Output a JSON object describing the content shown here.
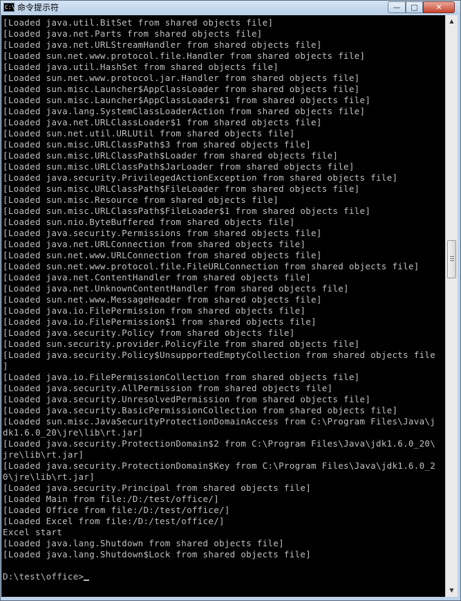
{
  "window": {
    "title": "命令提示符",
    "app_icon_text": "C:\\",
    "controls": {
      "minimize": "—",
      "maximize": "□",
      "close": "✕"
    }
  },
  "console": {
    "lines": [
      "[Loaded java.util.BitSet from shared objects file]",
      "[Loaded java.net.Parts from shared objects file]",
      "[Loaded java.net.URLStreamHandler from shared objects file]",
      "[Loaded sun.net.www.protocol.file.Handler from shared objects file]",
      "[Loaded java.util.HashSet from shared objects file]",
      "[Loaded sun.net.www.protocol.jar.Handler from shared objects file]",
      "[Loaded sun.misc.Launcher$AppClassLoader from shared objects file]",
      "[Loaded sun.misc.Launcher$AppClassLoader$1 from shared objects file]",
      "[Loaded java.lang.SystemClassLoaderAction from shared objects file]",
      "[Loaded java.net.URLClassLoader$1 from shared objects file]",
      "[Loaded sun.net.util.URLUtil from shared objects file]",
      "[Loaded sun.misc.URLClassPath$3 from shared objects file]",
      "[Loaded sun.misc.URLClassPath$Loader from shared objects file]",
      "[Loaded sun.misc.URLClassPath$JarLoader from shared objects file]",
      "[Loaded java.security.PrivilegedActionException from shared objects file]",
      "[Loaded sun.misc.URLClassPath$FileLoader from shared objects file]",
      "[Loaded sun.misc.Resource from shared objects file]",
      "[Loaded sun.misc.URLClassPath$FileLoader$1 from shared objects file]",
      "[Loaded sun.nio.ByteBuffered from shared objects file]",
      "[Loaded java.security.Permissions from shared objects file]",
      "[Loaded java.net.URLConnection from shared objects file]",
      "[Loaded sun.net.www.URLConnection from shared objects file]",
      "[Loaded sun.net.www.protocol.file.FileURLConnection from shared objects file]",
      "[Loaded java.net.ContentHandler from shared objects file]",
      "[Loaded java.net.UnknownContentHandler from shared objects file]",
      "[Loaded sun.net.www.MessageHeader from shared objects file]",
      "[Loaded java.io.FilePermission from shared objects file]",
      "[Loaded java.io.FilePermission$1 from shared objects file]",
      "[Loaded java.security.Policy from shared objects file]",
      "[Loaded sun.security.provider.PolicyFile from shared objects file]",
      "[Loaded java.security.Policy$UnsupportedEmptyCollection from shared objects file",
      "]",
      "[Loaded java.io.FilePermissionCollection from shared objects file]",
      "[Loaded java.security.AllPermission from shared objects file]",
      "[Loaded java.security.UnresolvedPermission from shared objects file]",
      "[Loaded java.security.BasicPermissionCollection from shared objects file]",
      "[Loaded sun.misc.JavaSecurityProtectionDomainAccess from C:\\Program Files\\Java\\j",
      "dk1.6.0_20\\jre\\lib\\rt.jar]",
      "[Loaded java.security.ProtectionDomain$2 from C:\\Program Files\\Java\\jdk1.6.0_20\\",
      "jre\\lib\\rt.jar]",
      "[Loaded java.security.ProtectionDomain$Key from C:\\Program Files\\Java\\jdk1.6.0_2",
      "0\\jre\\lib\\rt.jar]",
      "[Loaded java.security.Principal from shared objects file]",
      "[Loaded Main from file:/D:/test/office/]",
      "[Loaded Office from file:/D:/test/office/]",
      "[Loaded Excel from file:/D:/test/office/]",
      "Excel start",
      "[Loaded java.lang.Shutdown from shared objects file]",
      "[Loaded java.lang.Shutdown$Lock from shared objects file]",
      ""
    ],
    "prompt": "D:\\test\\office>"
  },
  "scrollbar": {
    "up_arrow": "▲",
    "down_arrow": "▼"
  },
  "colors": {
    "console_bg": "#000000",
    "console_text": "#c0c0c0",
    "title_bar": "#c6daf0"
  }
}
